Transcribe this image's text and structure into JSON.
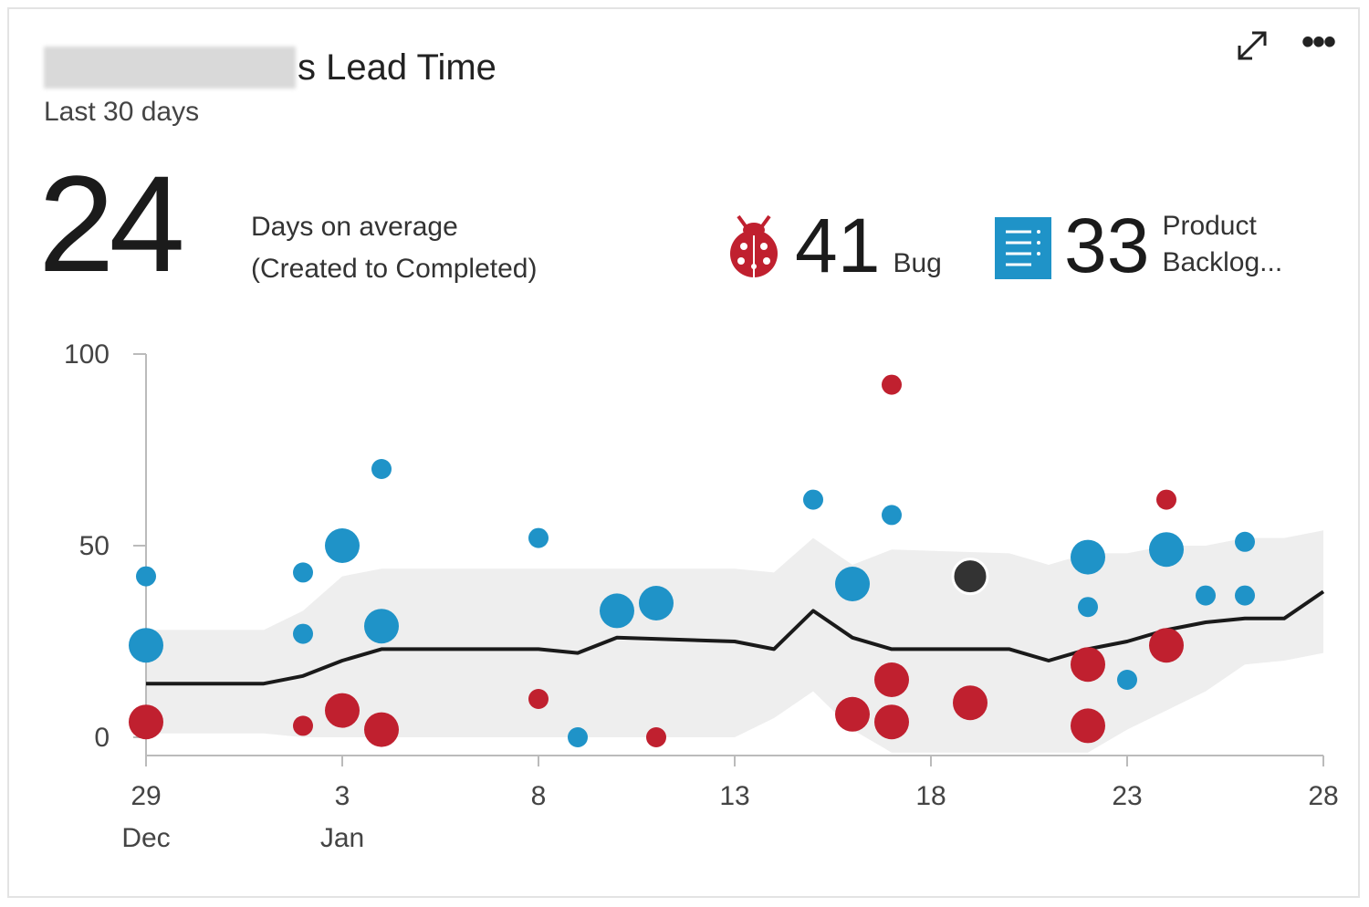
{
  "header": {
    "title": "s Lead Time",
    "subtitle": "Last 30 days"
  },
  "summary": {
    "average_days": "24",
    "average_label_line1": "Days on average",
    "average_label_line2": "(Created to Completed)"
  },
  "stats": {
    "bug_count": "41",
    "bug_label": "Bug",
    "bug_icon": "ladybug-icon",
    "pb_count": "33",
    "pb_label_line1": "Product",
    "pb_label_line2": "Backlog...",
    "pb_icon": "backlog-item-icon"
  },
  "toolbar": {
    "expand_icon": "expand-icon",
    "more_icon": "more-options-icon"
  },
  "colors": {
    "bug": "#c0202f",
    "pbi": "#1f93c8",
    "other": "#333333",
    "trend": "#1a1a1a",
    "band": "#eeeeee",
    "axis": "#bbbbbb"
  },
  "chart_data": {
    "type": "scatter",
    "y_ticks": [
      0,
      50,
      100
    ],
    "ylim": [
      0,
      100
    ],
    "x_domain": [
      0,
      30
    ],
    "x_ticks": [
      {
        "x": 0,
        "label1": "29",
        "label2": "Dec"
      },
      {
        "x": 5,
        "label1": "3",
        "label2": "Jan"
      },
      {
        "x": 10,
        "label1": "8",
        "label2": ""
      },
      {
        "x": 15,
        "label1": "13",
        "label2": ""
      },
      {
        "x": 20,
        "label1": "18",
        "label2": ""
      },
      {
        "x": 25,
        "label1": "23",
        "label2": ""
      },
      {
        "x": 30,
        "label1": "28",
        "label2": ""
      }
    ],
    "series": [
      {
        "key": "bug",
        "points": [
          {
            "x": 0,
            "y": 4,
            "size": "l"
          },
          {
            "x": 4,
            "y": 3,
            "size": "s"
          },
          {
            "x": 5,
            "y": 7,
            "size": "l"
          },
          {
            "x": 6,
            "y": 2,
            "size": "l"
          },
          {
            "x": 10,
            "y": 10,
            "size": "s"
          },
          {
            "x": 13,
            "y": 0,
            "size": "s"
          },
          {
            "x": 18,
            "y": 6,
            "size": "l"
          },
          {
            "x": 19,
            "y": 92,
            "size": "s"
          },
          {
            "x": 19,
            "y": 15,
            "size": "l"
          },
          {
            "x": 19,
            "y": 4,
            "size": "l"
          },
          {
            "x": 21,
            "y": 9,
            "size": "l"
          },
          {
            "x": 24,
            "y": 19,
            "size": "l"
          },
          {
            "x": 24,
            "y": 3,
            "size": "l"
          },
          {
            "x": 26,
            "y": 62,
            "size": "s"
          },
          {
            "x": 26,
            "y": 24,
            "size": "l"
          }
        ]
      },
      {
        "key": "pbi",
        "points": [
          {
            "x": 0,
            "y": 42,
            "size": "s"
          },
          {
            "x": 0,
            "y": 24,
            "size": "l"
          },
          {
            "x": 4,
            "y": 43,
            "size": "s"
          },
          {
            "x": 4,
            "y": 27,
            "size": "s"
          },
          {
            "x": 5,
            "y": 50,
            "size": "l"
          },
          {
            "x": 6,
            "y": 70,
            "size": "s"
          },
          {
            "x": 6,
            "y": 29,
            "size": "l"
          },
          {
            "x": 10,
            "y": 52,
            "size": "s"
          },
          {
            "x": 11,
            "y": 0,
            "size": "s"
          },
          {
            "x": 12,
            "y": 33,
            "size": "l"
          },
          {
            "x": 13,
            "y": 35,
            "size": "l"
          },
          {
            "x": 17,
            "y": 62,
            "size": "s"
          },
          {
            "x": 18,
            "y": 40,
            "size": "l"
          },
          {
            "x": 19,
            "y": 58,
            "size": "s"
          },
          {
            "x": 24,
            "y": 47,
            "size": "l"
          },
          {
            "x": 24,
            "y": 34,
            "size": "s"
          },
          {
            "x": 25,
            "y": 15,
            "size": "s"
          },
          {
            "x": 26,
            "y": 49,
            "size": "l"
          },
          {
            "x": 27,
            "y": 37,
            "size": "s"
          },
          {
            "x": 28,
            "y": 51,
            "size": "s"
          },
          {
            "x": 28,
            "y": 37,
            "size": "s"
          }
        ]
      },
      {
        "key": "other",
        "points": [
          {
            "x": 21,
            "y": 42,
            "size": "l"
          }
        ]
      }
    ],
    "trend": [
      {
        "x": 0,
        "y": 14
      },
      {
        "x": 3,
        "y": 14
      },
      {
        "x": 4,
        "y": 16
      },
      {
        "x": 5,
        "y": 20
      },
      {
        "x": 6,
        "y": 23
      },
      {
        "x": 10,
        "y": 23
      },
      {
        "x": 11,
        "y": 22
      },
      {
        "x": 12,
        "y": 26
      },
      {
        "x": 15,
        "y": 25
      },
      {
        "x": 16,
        "y": 23
      },
      {
        "x": 17,
        "y": 33
      },
      {
        "x": 18,
        "y": 26
      },
      {
        "x": 19,
        "y": 23
      },
      {
        "x": 22,
        "y": 23
      },
      {
        "x": 23,
        "y": 20
      },
      {
        "x": 24,
        "y": 23
      },
      {
        "x": 25,
        "y": 25
      },
      {
        "x": 26,
        "y": 28
      },
      {
        "x": 27,
        "y": 30
      },
      {
        "x": 28,
        "y": 31
      },
      {
        "x": 29,
        "y": 31
      },
      {
        "x": 30,
        "y": 38
      }
    ],
    "band": [
      {
        "x": 0,
        "y0": 1,
        "y1": 28
      },
      {
        "x": 3,
        "y0": 1,
        "y1": 28
      },
      {
        "x": 4,
        "y0": 0,
        "y1": 33
      },
      {
        "x": 5,
        "y0": 0,
        "y1": 42
      },
      {
        "x": 6,
        "y0": 0,
        "y1": 44
      },
      {
        "x": 10,
        "y0": 0,
        "y1": 44
      },
      {
        "x": 12,
        "y0": 0,
        "y1": 44
      },
      {
        "x": 15,
        "y0": 0,
        "y1": 44
      },
      {
        "x": 16,
        "y0": 5,
        "y1": 43
      },
      {
        "x": 17,
        "y0": 12,
        "y1": 52
      },
      {
        "x": 18,
        "y0": 2,
        "y1": 45
      },
      {
        "x": 19,
        "y0": -4,
        "y1": 49
      },
      {
        "x": 22,
        "y0": -4,
        "y1": 48
      },
      {
        "x": 23,
        "y0": -4,
        "y1": 45
      },
      {
        "x": 24,
        "y0": -4,
        "y1": 48
      },
      {
        "x": 25,
        "y0": 2,
        "y1": 48
      },
      {
        "x": 26,
        "y0": 7,
        "y1": 50
      },
      {
        "x": 27,
        "y0": 12,
        "y1": 50
      },
      {
        "x": 28,
        "y0": 19,
        "y1": 52
      },
      {
        "x": 29,
        "y0": 20,
        "y1": 52
      },
      {
        "x": 30,
        "y0": 22,
        "y1": 54
      }
    ]
  }
}
